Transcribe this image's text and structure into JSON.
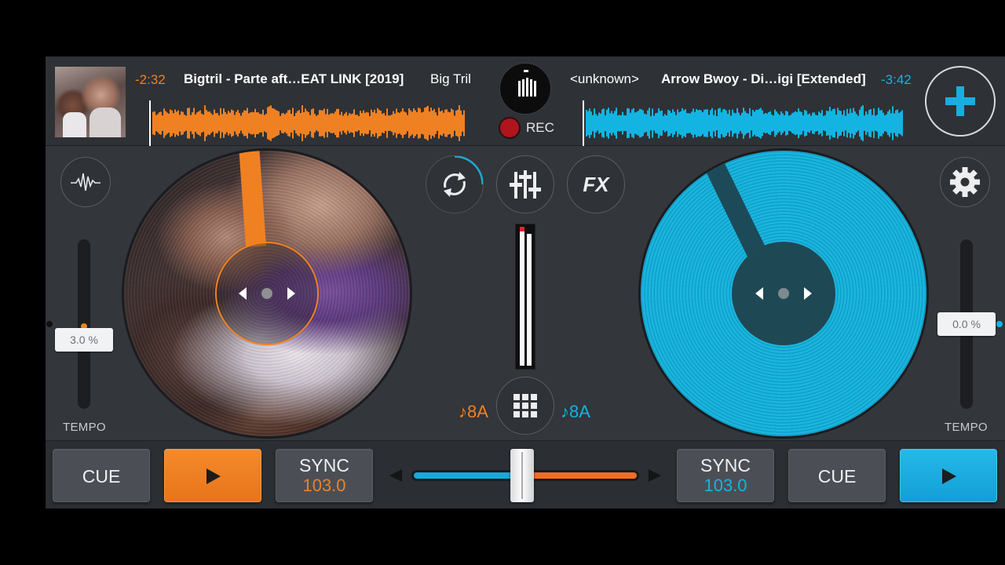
{
  "deckA": {
    "time_remaining": "-2:32",
    "title": "Bigtril  - Parte aft…EAT LINK [2019]",
    "artist": "Big Tril",
    "tempo": "3.0 %",
    "tempo_label": "TEMPO",
    "key": "♪8A",
    "cue_label": "CUE",
    "sync_label": "SYNC",
    "bpm": "103.0",
    "color": "#f08123"
  },
  "deckB": {
    "time_remaining": "-3:42",
    "title": "Arrow Bwoy - Di…igi [Extended]",
    "artist": "<unknown>",
    "tempo": "0.0 %",
    "tempo_label": "TEMPO",
    "key": "♪8A",
    "cue_label": "CUE",
    "sync_label": "SYNC",
    "bpm": "103.0",
    "color": "#14b4e2"
  },
  "recorder": {
    "label": "REC"
  },
  "center": {
    "fx_label": "FX"
  },
  "crossfader": {
    "position": 0.5
  },
  "icons": {
    "add": "plus-icon",
    "waveform": "waveform-icon",
    "loop": "loop-icon",
    "mixer": "mixer-sliders-icon",
    "settings": "gear-icon",
    "pads": "grid-icon",
    "play": "play-icon"
  }
}
